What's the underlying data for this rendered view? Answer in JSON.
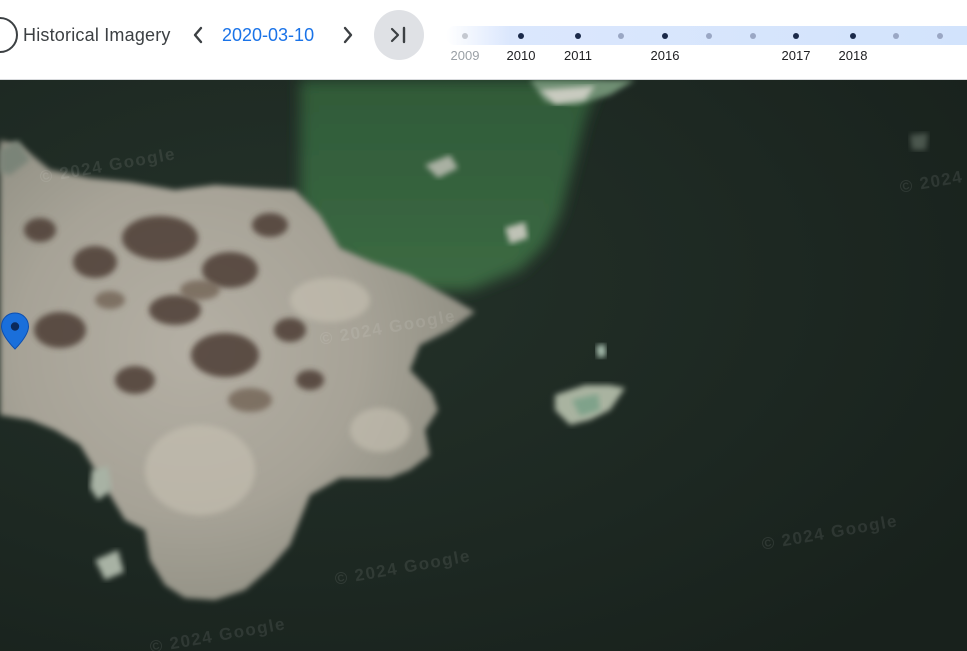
{
  "toolbar": {
    "title": "Historical Imagery",
    "date": "2020-03-10"
  },
  "timeline": {
    "years": [
      {
        "label": "2009",
        "faded": true
      },
      {
        "label": "2010"
      },
      {
        "label": "2011"
      },
      {
        "label": "2016"
      },
      {
        "label": "2017"
      },
      {
        "label": "2018"
      }
    ]
  },
  "map": {
    "watermark": "© 2024 Google"
  },
  "colors": {
    "accent": "#1a73e8",
    "pin": "#1a6fdb"
  }
}
